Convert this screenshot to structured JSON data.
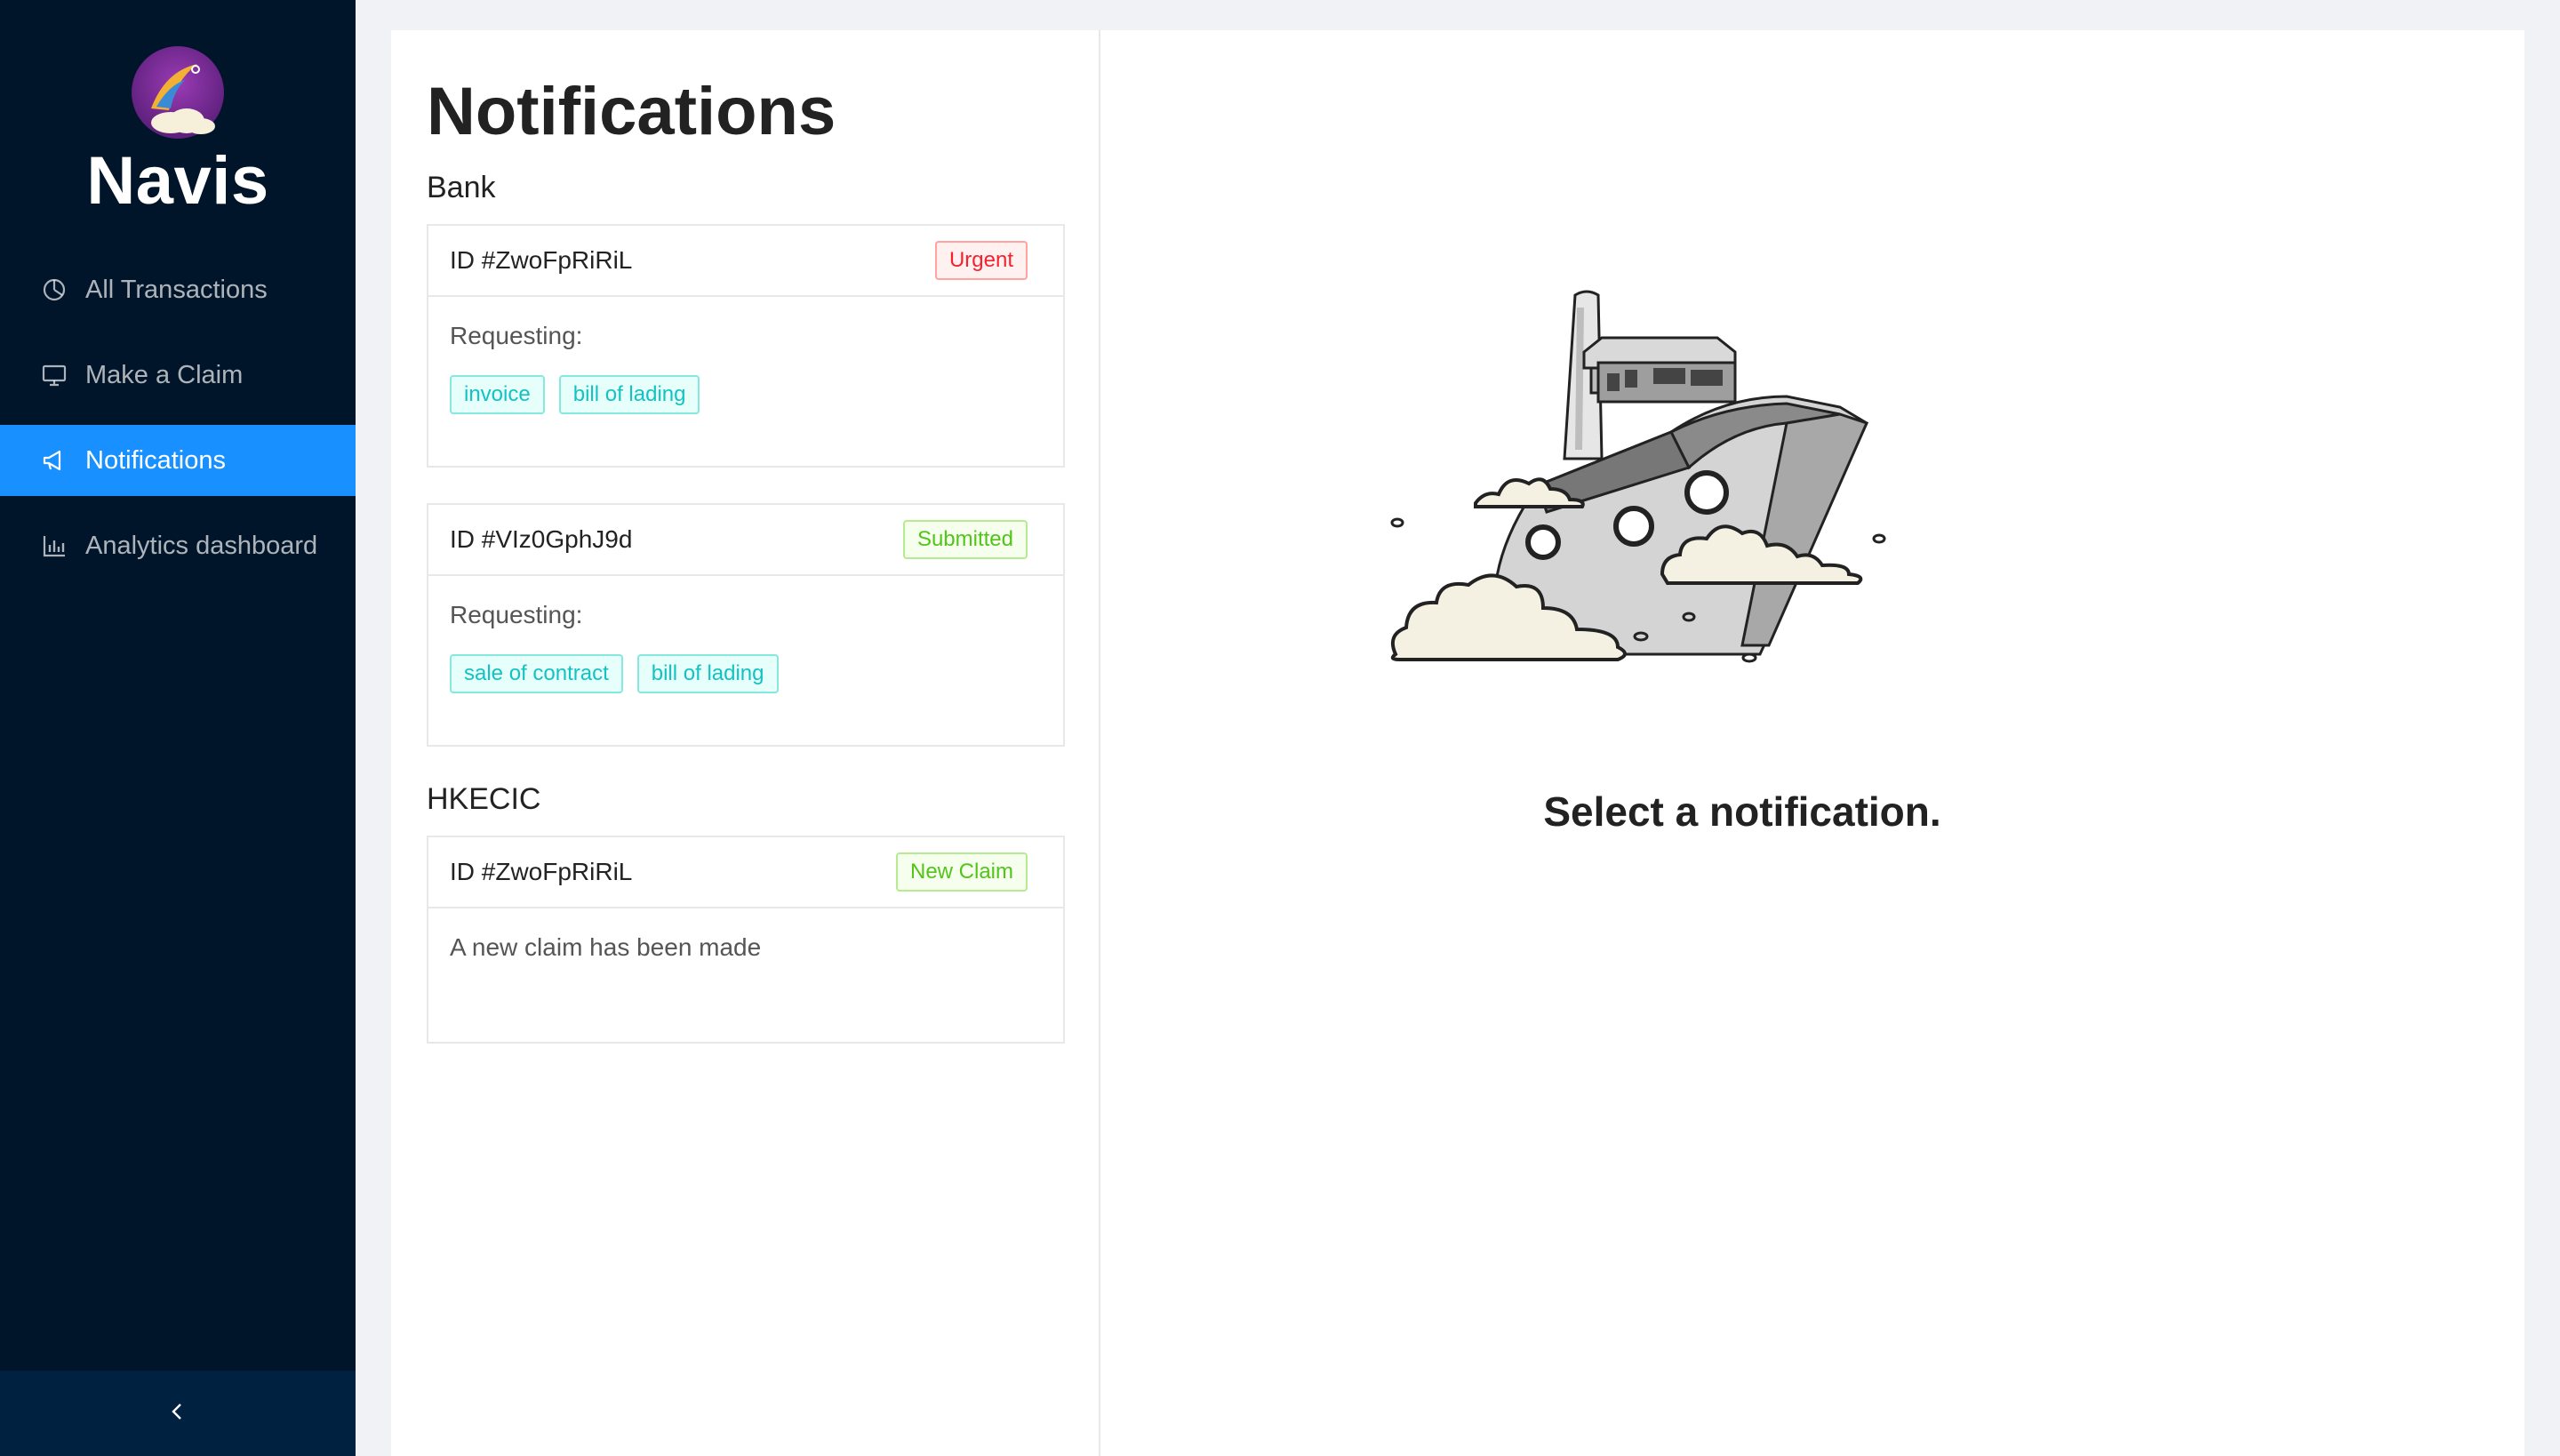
{
  "brand": {
    "name": "Navis"
  },
  "sidebar": {
    "items": [
      {
        "label": "All Transactions",
        "icon": "pie-chart-icon",
        "active": false
      },
      {
        "label": "Make a Claim",
        "icon": "desktop-icon",
        "active": false
      },
      {
        "label": "Notifications",
        "icon": "megaphone-icon",
        "active": true
      },
      {
        "label": "Analytics dashboard",
        "icon": "bar-chart-icon",
        "active": false
      }
    ],
    "collapse_icon": "chevron-left-icon"
  },
  "main": {
    "title": "Notifications",
    "groups": [
      {
        "name": "Bank",
        "notifications": [
          {
            "id": "ID #ZwoFpRiRiL",
            "status": "Urgent",
            "status_color": "#f5222d",
            "requesting_label": "Requesting:",
            "tags": [
              "invoice",
              "bill of lading"
            ]
          },
          {
            "id": "ID #VIz0GphJ9d",
            "status": "Submitted",
            "status_color": "#52c41a",
            "requesting_label": "Requesting:",
            "tags": [
              "sale of contract",
              "bill of lading"
            ]
          }
        ]
      },
      {
        "name": "HKECIC",
        "notifications": [
          {
            "id": "ID #ZwoFpRiRiL",
            "status": "New Claim",
            "status_color": "#52c41a",
            "message": "A new claim has been made"
          }
        ]
      }
    ],
    "empty_state": {
      "message": "Select a notification.",
      "illustration": "ship-illustration"
    }
  },
  "colors": {
    "sidebar_bg": "#001529",
    "active_item": "#1890ff",
    "tag_cyan": "#13c2c2"
  }
}
